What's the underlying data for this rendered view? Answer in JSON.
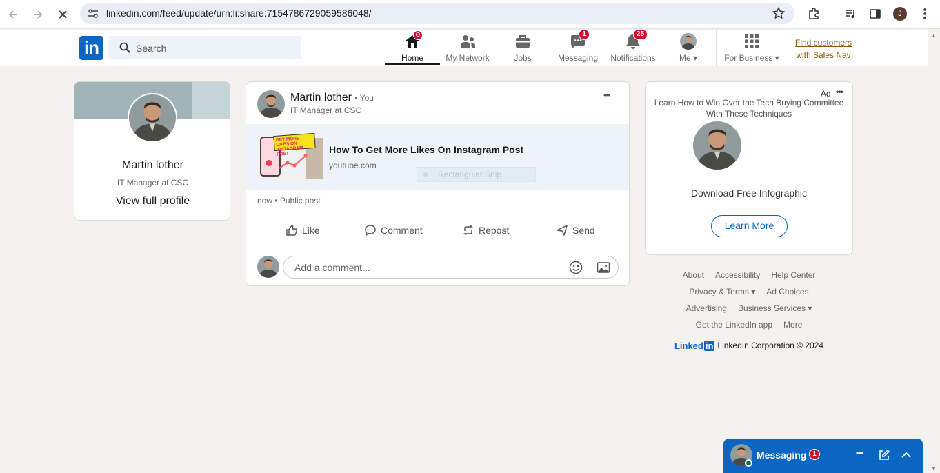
{
  "browser": {
    "url": "linkedin.com/feed/update/urn:li:share:7154786729059586048/",
    "profile_initial": "J"
  },
  "header": {
    "logo_text": "in",
    "search_placeholder": "Search",
    "nav": {
      "home": {
        "label": "Home"
      },
      "network": {
        "label": "My Network"
      },
      "jobs": {
        "label": "Jobs"
      },
      "messaging": {
        "label": "Messaging",
        "badge": "1"
      },
      "notifications": {
        "label": "Notifications",
        "badge": "25"
      },
      "me": {
        "label": "Me"
      },
      "business": {
        "label": "For Business"
      }
    },
    "sales_nav_line1": "Find customers",
    "sales_nav_line2": "with Sales Nav"
  },
  "profile_card": {
    "name": "Martin lother",
    "headline": "IT Manager at CSC",
    "view_profile": "View full profile"
  },
  "post": {
    "author": "Martin lother",
    "you_tag": "• You",
    "headline": "IT Manager at CSC",
    "more": "•••",
    "link_title": "How To Get More Likes On Instagram Post",
    "link_domain": "youtube.com",
    "thumb_text": "GET MORE LIKES ON INSTAGRAM POST",
    "snip_overlay": "Rectangular Snip",
    "meta": "now • Public post",
    "actions": {
      "like": "Like",
      "comment": "Comment",
      "repost": "Repost",
      "send": "Send"
    },
    "comment_placeholder": "Add a comment..."
  },
  "ad": {
    "label": "Ad",
    "more": "•••",
    "headline": "Learn How to Win Over the Tech Buying Committee With These Techniques",
    "cta_text": "Download Free Infographic",
    "button": "Learn More"
  },
  "footer": {
    "about": "About",
    "accessibility": "Accessibility",
    "help": "Help Center",
    "privacy": "Privacy & Terms",
    "ad_choices": "Ad Choices",
    "advertising": "Advertising",
    "business_services": "Business Services",
    "app": "Get the LinkedIn app",
    "more": "More",
    "brand": "Linked",
    "copyright": "LinkedIn Corporation © 2024"
  },
  "messaging_bar": {
    "label": "Messaging",
    "badge": "1"
  },
  "colors": {
    "brand": "#0a66c2",
    "badge": "#cb112d",
    "background": "#f4f2ee"
  }
}
